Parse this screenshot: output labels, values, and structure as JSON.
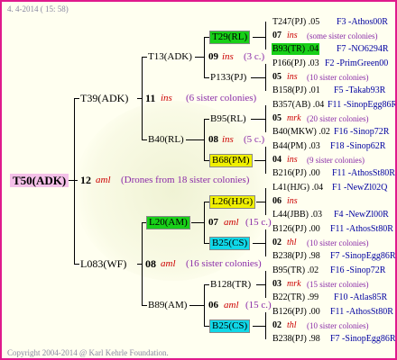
{
  "header": {
    "date": "4. 4-2014 ( 15: 58)"
  },
  "footer": {
    "copyright": "Copyright 2004-2014 @ Karl Kehrle Foundation."
  },
  "colors": {
    "border": "#e01a8c",
    "green": "#18d018",
    "yellow": "#f0f000",
    "cyan": "#10d8e8",
    "pink": "#f4c0e8",
    "red": "#cc0000",
    "blue": "#0000a0",
    "purple": "#8a2ba8"
  },
  "root": {
    "name": "T50(ADK)",
    "num": "12",
    "race": "aml",
    "note": "(Drones from 18 sister colonies)"
  },
  "gen1": {
    "top": {
      "name": "T39(ADK)",
      "num": "11",
      "race": "ins",
      "note": "(6 sister colonies)"
    },
    "bottom": {
      "name": "L083(WF)",
      "num": "08",
      "race": "aml",
      "note": "(16 sister colonies)"
    }
  },
  "gen2": {
    "a": {
      "name": "T13(ADK)",
      "num": "09",
      "race": "ins",
      "note": "(3 c.)"
    },
    "b": {
      "name": "B40(RL)",
      "num": "08",
      "race": "ins",
      "note": "(5 c.)"
    },
    "c": {
      "name": "L20(AM)",
      "num": "07",
      "race": "aml",
      "note": "(15 c.)"
    },
    "d": {
      "name": "B89(AM)",
      "num": "06",
      "race": "aml",
      "note": "(15 c.)"
    }
  },
  "gen3": {
    "a1": "T29(RL)",
    "a2": "P133(PJ)",
    "b1": "B95(RL)",
    "b2": "B68(PM)",
    "c1": "L26(HJG)",
    "c2": "B25(CS)",
    "d1": "B128(TR)",
    "d2": "B25(CS)"
  },
  "gen4": [
    {
      "sire": "T247(PJ) .05",
      "dam": "F3 -Athos00R",
      "num": "07",
      "race": "ins",
      "note": "(some sister colonies)",
      "sire2": "B93(TR) .04",
      "dam2": "F7 -NO6294R"
    },
    {
      "sire": "P166(PJ) .03",
      "dam": "F2 -PrimGreen00",
      "num": "05",
      "race": "ins",
      "note": "(10 sister colonies)",
      "sire2": "B158(PJ) .01",
      "dam2": "F5 -Takab93R"
    },
    {
      "sire": "B357(AB) .04",
      "dam": "F11 -SinopEgg86R",
      "num": "05",
      "race": "mrk",
      "note": "(20 sister colonies)",
      "sire2": "B40(MKW) .02",
      "dam2": "F16 -Sinop72R"
    },
    {
      "sire": "B44(PM) .03",
      "dam": "F18 -Sinop62R",
      "num": "04",
      "race": "ins",
      "note": "(9 sister colonies)",
      "sire2": "B216(PJ) .00",
      "dam2": "F11 -AthosSt80R"
    },
    {
      "sire": "L41(HJG) .04",
      "dam": "F1 -NewZl02Q",
      "num": "06",
      "race": "ins",
      "note": "",
      "sire2": "L44(JBB) .03",
      "dam2": "F4 -NewZl00R"
    },
    {
      "sire": "B126(PJ) .00",
      "dam": "F11 -AthosSt80R",
      "num": "02",
      "race": "thl",
      "note": "(10 sister colonies)",
      "sire2": "B238(PJ) .98",
      "dam2": "F7 -SinopEgg86R"
    },
    {
      "sire": "B95(TR) .02",
      "dam": "F16 -Sinop72R",
      "num": "03",
      "race": "mrk",
      "note": "(15 sister colonies)",
      "sire2": "B22(TR) .99",
      "dam2": "F10 -Atlas85R"
    },
    {
      "sire": "B126(PJ) .00",
      "dam": "F11 -AthosSt80R",
      "num": "02",
      "race": "thl",
      "note": "(10 sister colonies)",
      "sire2": "B238(PJ) .98",
      "dam2": "F7 -SinopEgg86R"
    }
  ]
}
